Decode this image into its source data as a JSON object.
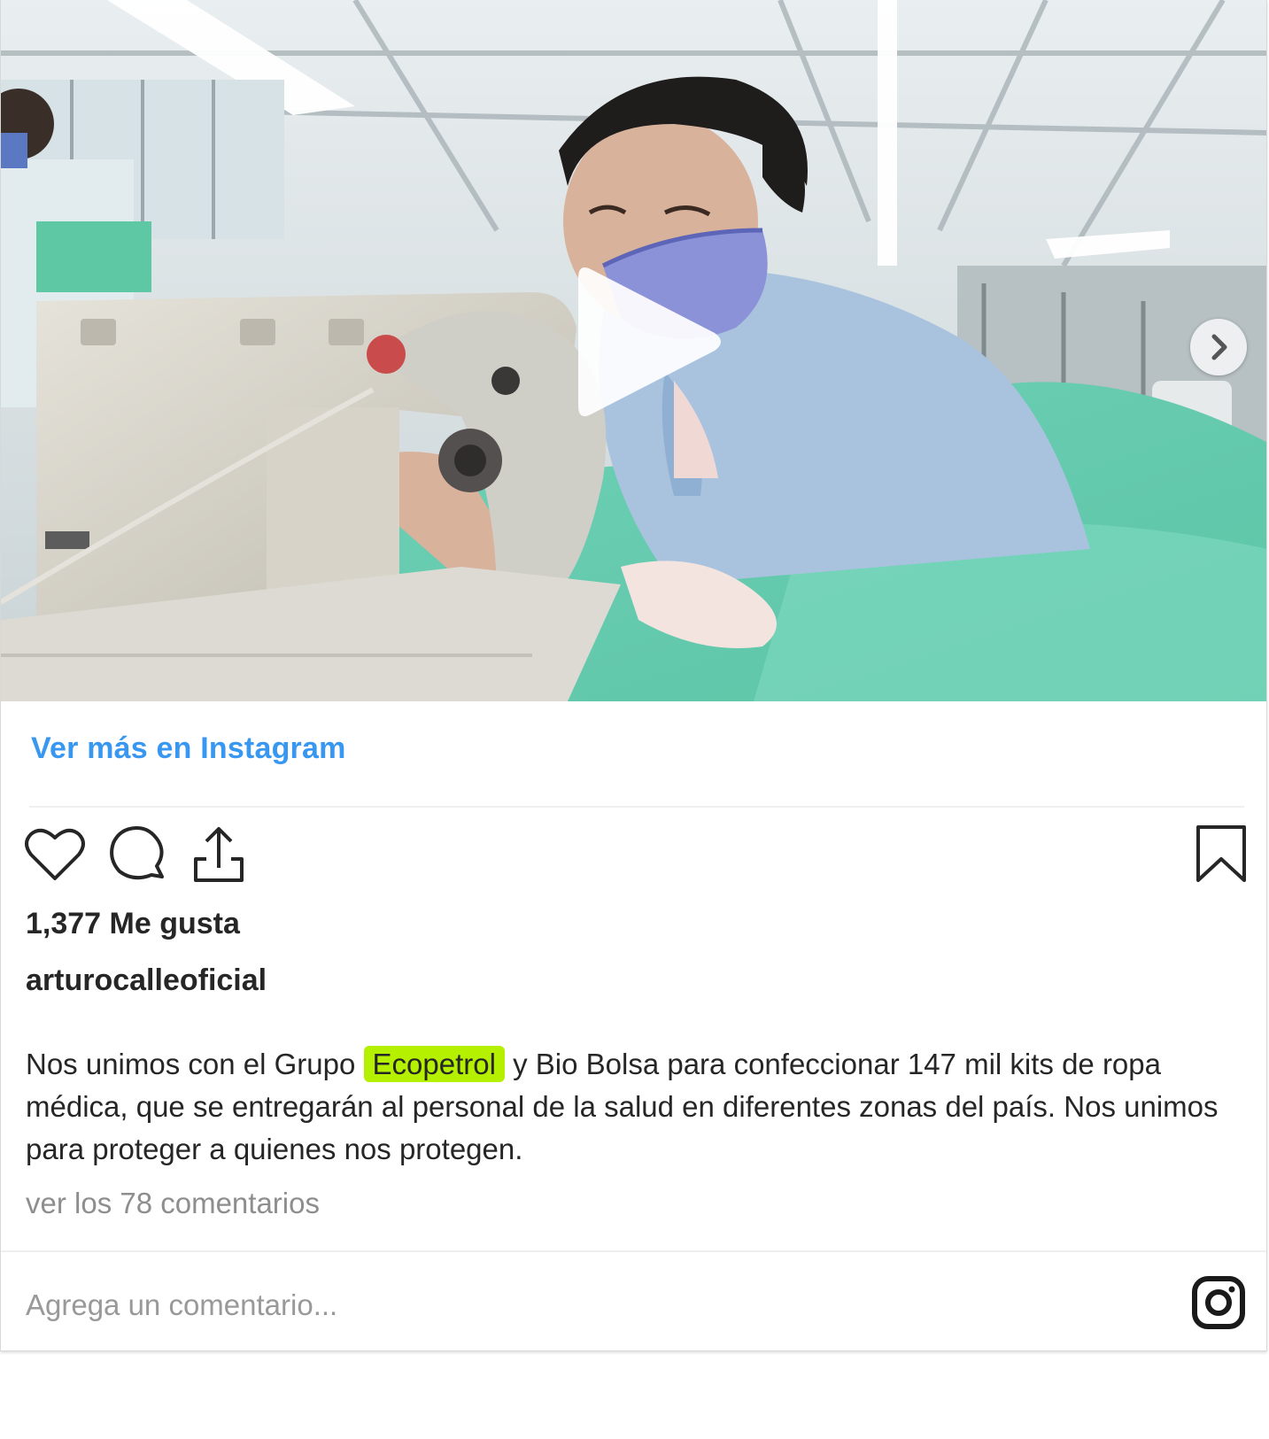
{
  "post": {
    "view_more_label": "Ver más en Instagram",
    "likes_text": "1,377 Me gusta",
    "username": "arturocalleoficial",
    "caption": {
      "before": "Nos unimos con el Grupo ",
      "highlight": "Ecopetrol",
      "after": " y Bio Bolsa para confeccionar 147 mil kits de ropa médica, que se entregarán al personal de la salud en diferentes zonas del país. Nos unimos para proteger a quienes nos protegen."
    },
    "view_comments_label": "ver los 78 comentarios",
    "comment_placeholder": "Agrega un comentario..."
  },
  "colors": {
    "link_blue": "#3897f0",
    "text_dark": "#262626",
    "text_muted": "#8e8e8e",
    "highlight": "#b4f000"
  },
  "icons": [
    "play-icon",
    "chevron-right-icon",
    "heart-icon",
    "comment-icon",
    "share-icon",
    "bookmark-icon",
    "instagram-logo-icon"
  ]
}
